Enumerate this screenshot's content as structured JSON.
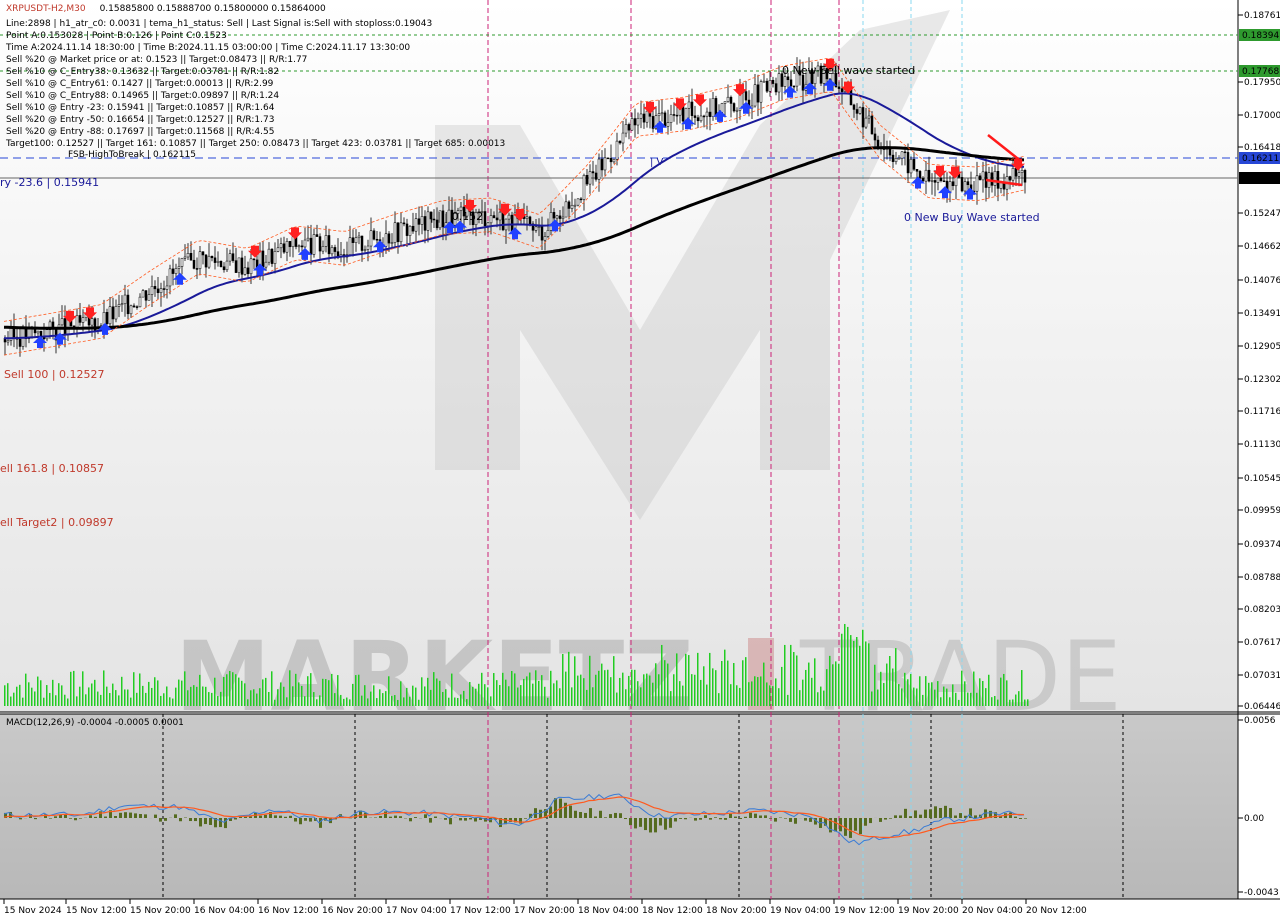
{
  "header": {
    "symbol_line": "XRPUSDT-H2,M30",
    "ohlc": "0.15885800 0.15888700 0.15800000 0.15864000",
    "lines": [
      "Line:2898  |  h1_atr_c0: 0.0031  |  tema_h1_status: Sell  |  Last Signal is:Sell with stoploss:0.19043",
      "Point A:0.153028  |  Point B:0.126  |  Point C:0.1523",
      "Time A:2024.11.14 18:30:00  |  Time B:2024.11.15 03:00:00  |  Time C:2024.11.17 13:30:00",
      "Sell %20 @ Market price or at: 0.1523  ||  Target:0.08473  ||  R/R:1.77",
      "Sell %10 @ C_Entry38: 0.13632  ||  Target:0.03781  ||  R/R:1.82",
      "Sell %10 @ C_Entry61: 0.1427  ||  Target:0.00013  ||  R/R:2.99",
      "Sell %10 @ C_Entry88: 0.14965  ||  Target:0.09897  ||  R/R:1.24",
      "Sell %10 @ Entry -23: 0.15941  ||  Target:0.10857  ||  R/R:1.64",
      "Sell %20 @ Entry -50: 0.16654  ||  Target:0.12527  ||  R/R:1.73",
      "Sell %20 @ Entry -88: 0.17697  ||  Target:0.11568  ||  R/R:4.55",
      "Target100: 0.12527  ||  Target 161: 0.10857  ||  Target 250: 0.08473  ||  Target 423: 0.03781  ||  Target 685: 0.00013"
    ],
    "fsb": "FSB-HighToBreak  |  0.162115"
  },
  "chart_labels": {
    "entry_23": "ry -23.6 | 0.15941",
    "sell_100": "Sell 100 | 0.12527",
    "sell_161": "ell 161.8 | 0.10857",
    "sell_target2": "ell Target2 | 0.09897",
    "sell_wave": "0 New Sell wave started",
    "buy_wave": "0 New Buy Wave started",
    "mid_label": "| | | 0.152",
    "ba": "| V"
  },
  "price_axis": {
    "ticks": [
      "0.18761",
      "0.17950",
      "0.17000",
      "0.16418",
      "0.15247",
      "0.14662",
      "0.14076",
      "0.13491",
      "0.12905",
      "0.12302",
      "0.11716",
      "0.11130",
      "0.10545",
      "0.09959",
      "0.09374",
      "0.08788",
      "0.08203",
      "0.07617",
      "0.07031",
      "0.06446"
    ],
    "tags": [
      {
        "text": "0.18394",
        "color": "#2e9a2e"
      },
      {
        "text": "0.17768",
        "color": "#2e9a2e"
      },
      {
        "text": "0.16211",
        "color": "#2646d6"
      },
      {
        "text": "0.15864",
        "color": "#000000"
      }
    ]
  },
  "macd": {
    "label": "MACD(12,26,9) -0.0004 -0.0005 0.0001",
    "ticks": [
      "0.0056",
      "0.00",
      "-0.0043"
    ]
  },
  "time_axis": [
    "15 Nov 2024",
    "15 Nov 12:00",
    "15 Nov 20:00",
    "16 Nov 04:00",
    "16 Nov 12:00",
    "16 Nov 20:00",
    "17 Nov 04:00",
    "17 Nov 12:00",
    "17 Nov 20:00",
    "18 Nov 04:00",
    "18 Nov 12:00",
    "18 Nov 20:00",
    "19 Nov 04:00",
    "19 Nov 12:00",
    "19 Nov 20:00",
    "20 Nov 04:00",
    "20 Nov 12:00"
  ],
  "watermark": {
    "left": "MARKETZ",
    "right": "TRADE"
  },
  "colors": {
    "ema_fast": "#1a1a99",
    "ema_slow": "#000000",
    "candle_up": "#000000",
    "sell_arrow": "#ff2020",
    "buy_arrow": "#2040ff",
    "macd_hist": "#556b1f",
    "macd_line": "#3a7bd5",
    "signal_line": "#ff5a1f",
    "volume": "#22cc22",
    "vline_magenta": "#cc2277",
    "vline_cyan": "#88d8f0"
  },
  "chart_data": {
    "type": "line",
    "title": "XRPUSDT-H2,M30",
    "ylim": [
      0.06446,
      0.18761
    ],
    "series": [
      {
        "name": "close",
        "x": [
          "15 Nov 00:00",
          "15 Nov 06:00",
          "15 Nov 12:00",
          "15 Nov 18:00",
          "16 Nov 00:00",
          "16 Nov 06:00",
          "16 Nov 12:00",
          "16 Nov 18:00",
          "17 Nov 00:00",
          "17 Nov 06:00",
          "17 Nov 12:00",
          "17 Nov 18:00",
          "18 Nov 00:00",
          "18 Nov 06:00",
          "18 Nov 12:00",
          "18 Nov 18:00",
          "19 Nov 00:00",
          "19 Nov 06:00",
          "19 Nov 12:00",
          "19 Nov 18:00",
          "20 Nov 00:00",
          "20 Nov 06:00"
        ],
        "values": [
          0.13,
          0.1315,
          0.133,
          0.139,
          0.1445,
          0.143,
          0.147,
          0.146,
          0.149,
          0.1515,
          0.152,
          0.149,
          0.158,
          0.169,
          0.17,
          0.172,
          0.1755,
          0.177,
          0.165,
          0.158,
          0.1575,
          0.1595
        ]
      }
    ],
    "annotations": [
      "0 New Sell wave started",
      "0 New Buy Wave started"
    ]
  }
}
